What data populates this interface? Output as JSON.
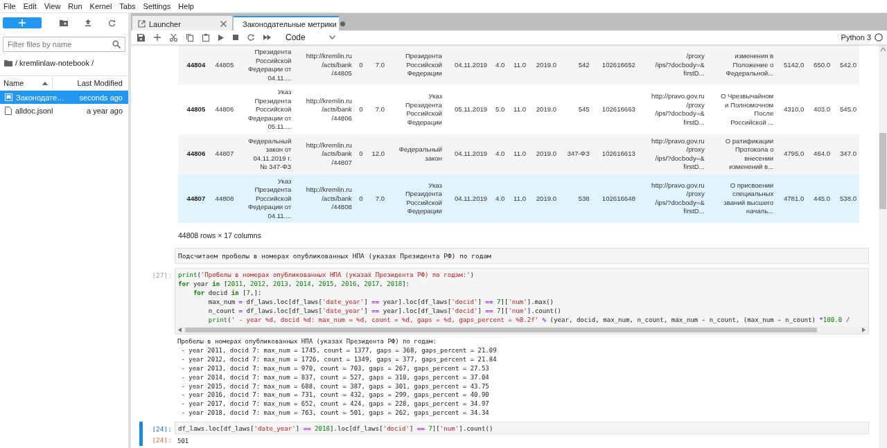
{
  "menu": [
    "File",
    "Edit",
    "View",
    "Run",
    "Kernel",
    "Tabs",
    "Settings",
    "Help"
  ],
  "file_browser": {
    "filter": {
      "placeholder": "Filter files by name"
    },
    "breadcrumb": "/ kremlinlaw-notebook /",
    "columns": [
      "Name",
      "Last Modified"
    ],
    "files": [
      {
        "name": "Законодате…",
        "modified": "seconds ago",
        "kind": "notebook",
        "selected": true
      },
      {
        "name": "alldoc.jsonl",
        "modified": "a year ago",
        "kind": "file",
        "selected": false
      }
    ]
  },
  "tabs": [
    {
      "label": "Launcher",
      "kind": "launcher",
      "selected": false,
      "modified": false
    },
    {
      "label": "Законодательные метрики",
      "kind": "notebook",
      "selected": true,
      "modified": true
    }
  ],
  "toolbar": {
    "cell_type": "Code",
    "kernel": "Python 3"
  },
  "table": {
    "rows": [
      {
        "index": "44804",
        "highlighted": false,
        "cells": [
          "44805",
          "Президента\nРоссийской\nФедерации от\n04.11....",
          "http://kremlin.ru\n/acts/bank\n/44805",
          "0",
          "7.0",
          "Президента\nРоссийской\nФедерации",
          "04.11.2019",
          "4.0",
          "11.0",
          "2019.0",
          "542",
          "102616652",
          "/proxy\n/ips/?docbody=&\nfirstD...",
          "изменения в\nПоложение о\nФедеральной...",
          "5142.0",
          "650.0",
          "542.0"
        ]
      },
      {
        "index": "44805",
        "highlighted": false,
        "cells": [
          "44806",
          "Указ\nПрезидента\nРоссийской\nФедерации от\n05.11....",
          "http://kremlin.ru\n/acts/bank\n/44806",
          "0",
          "7.0",
          "Указ\nПрезидента\nРоссийской\nФедерации",
          "05.11.2019",
          "5.0",
          "11.0",
          "2019.0",
          "545",
          "102616663",
          "http://pravo.gov.ru\n/proxy\n/ips/?docbody=&\nfirstD...",
          "О Чрезвычайном\nи Полномочном\nПосле\nРоссийской ...",
          "4310.0",
          "403.0",
          "545.0"
        ]
      },
      {
        "index": "44806",
        "highlighted": false,
        "cells": [
          "44807",
          "Федеральный\nзакон от\n04.11.2019 г.\n№ 347-ФЗ",
          "http://kremlin.ru\n/acts/bank\n/44807",
          "0",
          "12.0",
          "Федеральный\nзакон",
          "04.11.2019",
          "4.0",
          "11.0",
          "2019.0",
          "347-ФЗ",
          "102616613",
          "http://pravo.gov.ru\n/proxy\n/ips/?docbody=&\nfirstD...",
          "О ратификации\nПротокола о\nвнесении\nизменений в...",
          "4795.0",
          "464.0",
          "347.0"
        ]
      },
      {
        "index": "44807",
        "highlighted": true,
        "cells": [
          "44808",
          "Указ\nПрезидента\nРоссийской\nФедерации от\n04.11....",
          "http://kremlin.ru\n/acts/bank\n/44808",
          "0",
          "7.0",
          "Указ\nПрезидента\nРоссийской\nФедерации",
          "04.11.2019",
          "4.0",
          "11.0",
          "2019.0",
          "538",
          "102616648",
          "http://pravo.gov.ru\n/proxy\n/ips/?docbody=&\nfirstD...",
          "О присвоении\nспециальных\nзваний высшего\nначаль...",
          "4781.0",
          "445.0",
          "538.0"
        ]
      }
    ],
    "shape": "44808 rows × 17 columns"
  },
  "cells": [
    {
      "kind": "markdown",
      "selected": false,
      "text": "Подсчитаем пробелы в номерах опубликованных НПА (указах Президента РФ) по годам"
    },
    {
      "kind": "code",
      "selected": false,
      "prompt": "[27]:",
      "lines": [
        [
          {
            "kind": "builtin",
            "text": "print"
          },
          {
            "kind": "name",
            "text": "("
          },
          {
            "kind": "string",
            "text": "'Пробелы в номерах опубликованных НПА (указах Президента РФ) по годам:'"
          },
          {
            "kind": "name",
            "text": ")"
          }
        ],
        [
          {
            "kind": "keyword",
            "text": "for"
          },
          {
            "kind": "name",
            "text": " year "
          },
          {
            "kind": "keyword",
            "text": "in"
          },
          {
            "kind": "name",
            "text": " ["
          },
          {
            "kind": "number",
            "text": "2011"
          },
          {
            "kind": "name",
            "text": ", "
          },
          {
            "kind": "number",
            "text": "2012"
          },
          {
            "kind": "name",
            "text": ", "
          },
          {
            "kind": "number",
            "text": "2013"
          },
          {
            "kind": "name",
            "text": ", "
          },
          {
            "kind": "number",
            "text": "2014"
          },
          {
            "kind": "name",
            "text": ", "
          },
          {
            "kind": "number",
            "text": "2015"
          },
          {
            "kind": "name",
            "text": ", "
          },
          {
            "kind": "number",
            "text": "2016"
          },
          {
            "kind": "name",
            "text": ", "
          },
          {
            "kind": "number",
            "text": "2017"
          },
          {
            "kind": "name",
            "text": ", "
          },
          {
            "kind": "number",
            "text": "2018"
          },
          {
            "kind": "name",
            "text": "]:"
          }
        ],
        [
          {
            "kind": "keyword",
            "text": "    for"
          },
          {
            "kind": "name",
            "text": " docid "
          },
          {
            "kind": "keyword",
            "text": "in"
          },
          {
            "kind": "name",
            "text": " ["
          },
          {
            "kind": "number",
            "text": "7"
          },
          {
            "kind": "name",
            "text": ",]:"
          }
        ],
        [
          {
            "kind": "name",
            "text": "        max_num "
          },
          {
            "kind": "operator",
            "text": "="
          },
          {
            "kind": "name",
            "text": " df_laws.loc[df_laws["
          },
          {
            "kind": "string",
            "text": "'date_year'"
          },
          {
            "kind": "name",
            "text": "] "
          },
          {
            "kind": "operator",
            "text": "=="
          },
          {
            "kind": "name",
            "text": " year].loc[df_laws["
          },
          {
            "kind": "string",
            "text": "'docid'"
          },
          {
            "kind": "name",
            "text": "] "
          },
          {
            "kind": "operator",
            "text": "=="
          },
          {
            "kind": "number",
            "text": " 7"
          },
          {
            "kind": "name",
            "text": "]["
          },
          {
            "kind": "string",
            "text": "'num'"
          },
          {
            "kind": "name",
            "text": "].max()"
          }
        ],
        [
          {
            "kind": "name",
            "text": "        n_count "
          },
          {
            "kind": "operator",
            "text": "="
          },
          {
            "kind": "name",
            "text": " df_laws.loc[df_laws["
          },
          {
            "kind": "string",
            "text": "'date_year'"
          },
          {
            "kind": "name",
            "text": "] "
          },
          {
            "kind": "operator",
            "text": "=="
          },
          {
            "kind": "name",
            "text": " year].loc[df_laws["
          },
          {
            "kind": "string",
            "text": "'docid'"
          },
          {
            "kind": "name",
            "text": "] "
          },
          {
            "kind": "operator",
            "text": "=="
          },
          {
            "kind": "number",
            "text": " 7"
          },
          {
            "kind": "name",
            "text": "]["
          },
          {
            "kind": "string",
            "text": "'num'"
          },
          {
            "kind": "name",
            "text": "].count()"
          }
        ],
        [
          {
            "kind": "builtin",
            "text": "        print"
          },
          {
            "kind": "name",
            "text": "("
          },
          {
            "kind": "string",
            "text": "' - year %d, docid %d: max_num = %d, count = %d, gaps = %d, gaps_percent = %0.2f'"
          },
          {
            "kind": "operator",
            "text": " %"
          },
          {
            "kind": "name",
            "text": " (year, docid, max_num, n_count, max_num "
          },
          {
            "kind": "operator",
            "text": "-"
          },
          {
            "kind": "name",
            "text": " n_count, (max_num "
          },
          {
            "kind": "operator",
            "text": "-"
          },
          {
            "kind": "name",
            "text": " n_count) "
          },
          {
            "kind": "operator",
            "text": "*"
          },
          {
            "kind": "number",
            "text": "100.0"
          },
          {
            "kind": "operator",
            "text": " /"
          }
        ]
      ],
      "output": {
        "lines": [
          "Пробелы в номерах опубликованных НПА (указах Президента РФ) по годам:",
          " - year 2011, docid 7: max_num = 1745, count = 1377, gaps = 368, gaps_percent = 21.09",
          " - year 2012, docid 7: max_num = 1726, count = 1349, gaps = 377, gaps_percent = 21.84",
          " - year 2013, docid 7: max_num = 970, count = 703, gaps = 267, gaps_percent = 27.53",
          " - year 2014, docid 7: max_num = 837, count = 527, gaps = 310, gaps_percent = 37.04",
          " - year 2015, docid 7: max_num = 688, count = 387, gaps = 301, gaps_percent = 43.75",
          " - year 2016, docid 7: max_num = 731, count = 432, gaps = 299, gaps_percent = 40.90",
          " - year 2017, docid 7: max_num = 652, count = 424, gaps = 228, gaps_percent = 34.97",
          " - year 2018, docid 7: max_num = 763, count = 501, gaps = 262, gaps_percent = 34.34"
        ]
      }
    },
    {
      "kind": "code",
      "selected": true,
      "prompt": "[24]:",
      "lines": [
        [
          {
            "kind": "name",
            "text": "df_laws.loc[df_laws["
          },
          {
            "kind": "string",
            "text": "'date_year'"
          },
          {
            "kind": "name",
            "text": "] "
          },
          {
            "kind": "operator",
            "text": "=="
          },
          {
            "kind": "number",
            "text": " 2018"
          },
          {
            "kind": "name",
            "text": "].loc[df_laws["
          },
          {
            "kind": "string",
            "text": "'docid'"
          },
          {
            "kind": "name",
            "text": "] "
          },
          {
            "kind": "operator",
            "text": "=="
          },
          {
            "kind": "number",
            "text": " 7"
          },
          {
            "kind": "name",
            "text": "]["
          },
          {
            "kind": "string",
            "text": "'num'"
          },
          {
            "kind": "name",
            "text": "].count()"
          }
        ]
      ],
      "output": {
        "prompt": "[24]:",
        "lines": [
          "501"
        ]
      }
    }
  ]
}
